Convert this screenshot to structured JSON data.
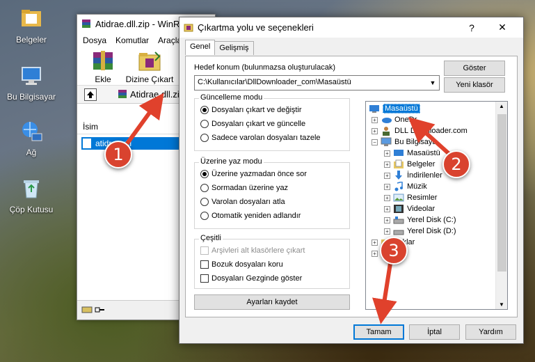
{
  "desktop": {
    "icons": [
      {
        "label": "Belgeler",
        "icon": "folder-icon"
      },
      {
        "label": "Bu Bilgisayar",
        "icon": "computer-icon"
      },
      {
        "label": "Ağ",
        "icon": "network-icon"
      },
      {
        "label": "Çöp Kutusu",
        "icon": "recycle-bin-icon"
      }
    ]
  },
  "winrar": {
    "title": "Atidrae.dll.zip - WinR",
    "menu": [
      "Dosya",
      "Komutlar",
      "Araçla"
    ],
    "toolbar": {
      "add_label": "Ekle",
      "extract_label": "Dizine Çıkart"
    },
    "address": "Atidrae.dll.zip",
    "list_header": "İsim",
    "file_name": "atidrae.dll"
  },
  "dialog": {
    "title": "Çıkartma yolu ve seçenekleri",
    "help": "?",
    "close": "✕",
    "tabs": [
      "Genel",
      "Gelişmiş"
    ],
    "dest_label": "Hedef konum (bulunmazsa oluşturulacak)",
    "dest_path": "C:\\Kullanıcılar\\DllDownloader_com\\Masaüstü",
    "show_button": "Göster",
    "new_folder_button": "Yeni klasör",
    "update_mode": {
      "title": "Güncelleme modu",
      "options": [
        "Dosyaları çıkart ve değiştir",
        "Dosyaları çıkart ve güncelle",
        "Sadece varolan dosyaları tazele"
      ]
    },
    "overwrite_mode": {
      "title": "Üzerine yaz modu",
      "options": [
        "Üzerine yazmadan önce sor",
        "Sormadan üzerine yaz",
        "Varolan dosyaları atla",
        "Otomatik yeniden adlandır"
      ]
    },
    "misc": {
      "title": "Çeşitli",
      "options": [
        "Arşivleri alt klasörlere çıkart",
        "Bozuk dosyaları koru",
        "Dosyaları Gezginde göster"
      ]
    },
    "save_settings_button": "Ayarları kaydet",
    "tree": {
      "items": [
        "Masaüstü",
        "OneDr",
        "DLL Downloader.com",
        "Bu Bilgisaya",
        "Masaüstü",
        "Belgeler",
        "İndirilenler",
        "Müzik",
        "Resimler",
        "Videolar",
        "Yerel Disk (C:)",
        "Yerel Disk (D:)",
        "plıklar"
      ]
    },
    "ok_button": "Tamam",
    "cancel_button": "İptal",
    "help_button": "Yardım"
  },
  "callouts": [
    "1",
    "2",
    "3"
  ],
  "colors": {
    "callout": "#d9432f",
    "selection": "#0078d7"
  }
}
